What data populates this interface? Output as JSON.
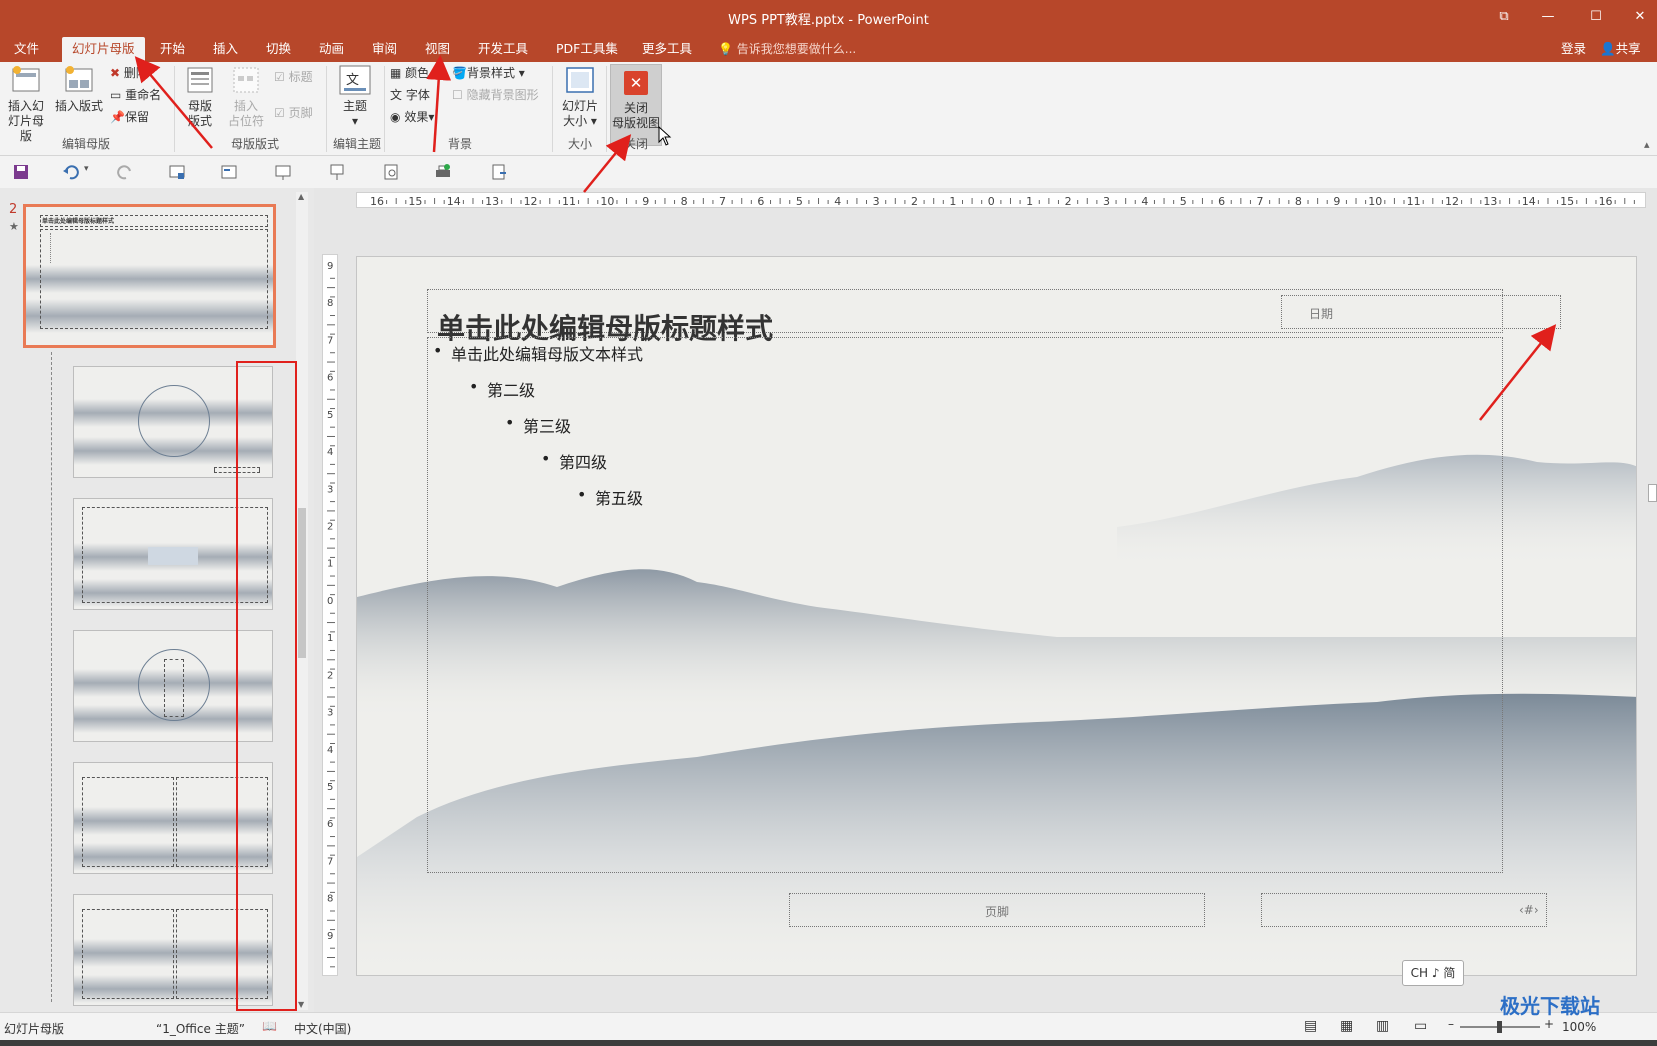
{
  "window": {
    "title": "WPS PPT教程.pptx - PowerPoint",
    "buttons": [
      "⧉",
      "—",
      "☐",
      "✕"
    ]
  },
  "tabs": [
    "文件",
    "幻灯片母版",
    "开始",
    "插入",
    "切换",
    "动画",
    "审阅",
    "视图",
    "开发工具",
    "PDF工具集",
    "更多工具"
  ],
  "tell_me": "告诉我您想要做什么...",
  "account": {
    "login": "登录",
    "share": "共享"
  },
  "ribbon": {
    "edit_master": {
      "insert_slide_master": [
        "插入幻",
        "灯片母版"
      ],
      "insert_layout": "插入版式",
      "delete": "删除",
      "rename": "重命名",
      "preserve": "保留",
      "group": "编辑母版"
    },
    "master_layout": {
      "master_layout_btn": [
        "母版",
        "版式"
      ],
      "insert_placeholder": [
        "插入",
        "占位符"
      ],
      "title_check": "标题",
      "footer_check": "页脚",
      "group": "母版版式"
    },
    "edit_theme": {
      "themes": "主题",
      "group": "编辑主题"
    },
    "background": {
      "colors": "颜色",
      "fonts": "字体",
      "effects": "效果",
      "bg_styles": "背景样式",
      "hide_bg": "隐藏背景图形",
      "group": "背景"
    },
    "size": {
      "slide_size": [
        "幻灯片",
        "大小"
      ],
      "group": "大小"
    },
    "close": {
      "close_master": [
        "关闭",
        "母版视图"
      ],
      "group": "关闭"
    }
  },
  "thumbnails": {
    "master_number": "2",
    "master_title": "单击此处编辑母版标题样式"
  },
  "ruler": {
    "h_labels": [
      "16",
      "15",
      "14",
      "13",
      "12",
      "11",
      "10",
      "9",
      "8",
      "7",
      "6",
      "5",
      "4",
      "3",
      "2",
      "1",
      "0",
      "1",
      "2",
      "3",
      "4",
      "5",
      "6",
      "7",
      "8",
      "9",
      "10",
      "11",
      "12",
      "13",
      "14",
      "15",
      "16"
    ],
    "v_labels": [
      "9",
      "8",
      "7",
      "6",
      "5",
      "4",
      "3",
      "2",
      "1",
      "0",
      "1",
      "2",
      "3",
      "4",
      "5",
      "6",
      "7",
      "8",
      "9"
    ]
  },
  "slide": {
    "title": "单击此处编辑母版标题样式",
    "date_label": "日期",
    "bullets": [
      {
        "level": 1,
        "text": "单击此处编辑母版文本样式"
      },
      {
        "level": 2,
        "text": "第二级"
      },
      {
        "level": 3,
        "text": "第三级"
      },
      {
        "level": 4,
        "text": "第四级"
      },
      {
        "level": 5,
        "text": "第五级"
      }
    ],
    "footer_label": "页脚",
    "number_label": "‹#›"
  },
  "ime": "CH ♪ 简",
  "status": {
    "view": "幻灯片母版",
    "theme": "“1_Office 主题”",
    "language": "中文(中国)",
    "zoom": "100%"
  },
  "watermark": "极光下载站",
  "colors": {
    "accent": "#b7472a",
    "ribbon_bg": "#f3f3f3",
    "annotation": "#e0201c"
  }
}
